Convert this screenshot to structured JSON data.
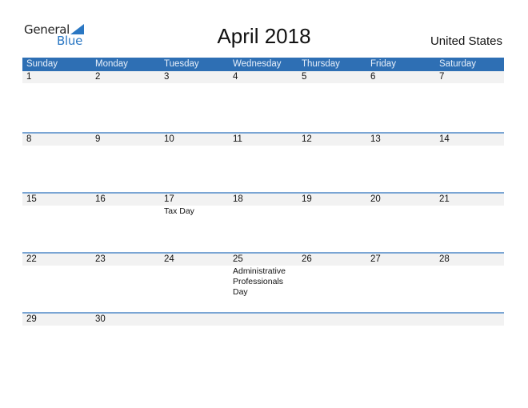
{
  "logo": {
    "word1": "General",
    "word2": "Blue"
  },
  "header": {
    "title": "April 2018",
    "country": "United States"
  },
  "colors": {
    "header_bar": "#2e6fb4",
    "week_separator": "#7aa5d4",
    "date_row_bg": "#f2f2f2",
    "logo_blue": "#2a77c3"
  },
  "weekdays": [
    "Sunday",
    "Monday",
    "Tuesday",
    "Wednesday",
    "Thursday",
    "Friday",
    "Saturday"
  ],
  "weeks": [
    {
      "dates": [
        "1",
        "2",
        "3",
        "4",
        "5",
        "6",
        "7"
      ],
      "events": [
        "",
        "",
        "",
        "",
        "",
        "",
        ""
      ]
    },
    {
      "dates": [
        "8",
        "9",
        "10",
        "11",
        "12",
        "13",
        "14"
      ],
      "events": [
        "",
        "",
        "",
        "",
        "",
        "",
        ""
      ]
    },
    {
      "dates": [
        "15",
        "16",
        "17",
        "18",
        "19",
        "20",
        "21"
      ],
      "events": [
        "",
        "",
        "Tax Day",
        "",
        "",
        "",
        ""
      ]
    },
    {
      "dates": [
        "22",
        "23",
        "24",
        "25",
        "26",
        "27",
        "28"
      ],
      "events": [
        "",
        "",
        "",
        "Administrative Professionals Day",
        "",
        "",
        ""
      ]
    },
    {
      "dates": [
        "29",
        "30",
        "",
        "",
        "",
        "",
        ""
      ],
      "events": [
        "",
        "",
        "",
        "",
        "",
        "",
        ""
      ]
    }
  ]
}
